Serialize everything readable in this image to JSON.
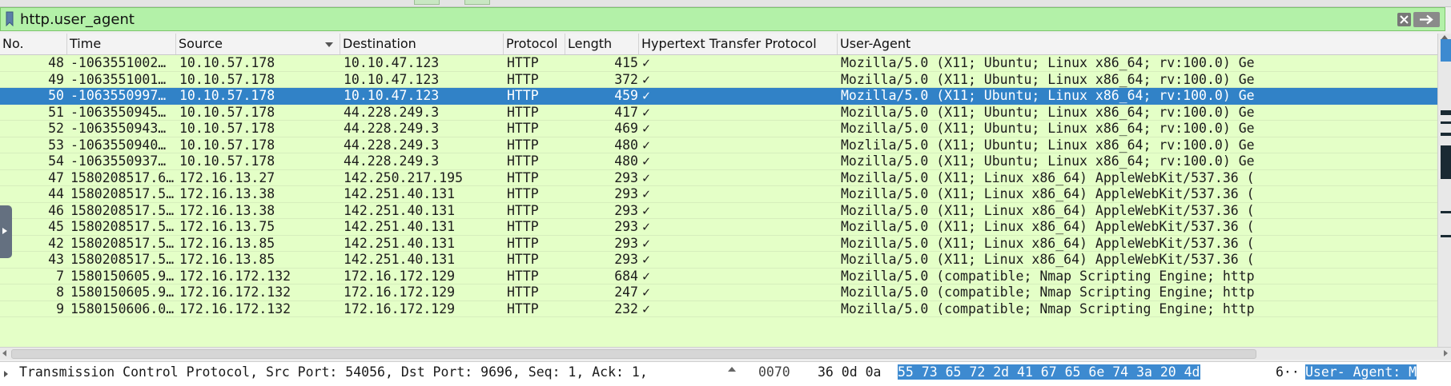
{
  "filter": {
    "value": "http.user_agent"
  },
  "columns": [
    {
      "label": "No."
    },
    {
      "label": "Time"
    },
    {
      "label": "Source"
    },
    {
      "label": "Destination"
    },
    {
      "label": "Protocol"
    },
    {
      "label": "Length"
    },
    {
      "label": "Hypertext Transfer Protocol"
    },
    {
      "label": "User-Agent"
    }
  ],
  "packets": [
    {
      "no": "48",
      "time": "-1063551002…",
      "src": "10.10.57.178",
      "dst": "10.10.47.123",
      "proto": "HTTP",
      "len": "415",
      "http": "✓",
      "ua": "Mozilla/5.0 (X11; Ubuntu; Linux x86_64; rv:100.0) Ge",
      "selected": false
    },
    {
      "no": "49",
      "time": "-1063551001…",
      "src": "10.10.57.178",
      "dst": "10.10.47.123",
      "proto": "HTTP",
      "len": "372",
      "http": "✓",
      "ua": "Mozilla/5.0 (X11; Ubuntu; Linux x86_64; rv:100.0) Ge",
      "selected": false
    },
    {
      "no": "50",
      "time": "-1063550997…",
      "src": "10.10.57.178",
      "dst": "10.10.47.123",
      "proto": "HTTP",
      "len": "459",
      "http": "✓",
      "ua": "Mozilla/5.0 (X11; Ubuntu; Linux x86_64; rv:100.0) Ge",
      "selected": true
    },
    {
      "no": "51",
      "time": "-1063550945…",
      "src": "10.10.57.178",
      "dst": "44.228.249.3",
      "proto": "HTTP",
      "len": "417",
      "http": "✓",
      "ua": "Mozilla/5.0 (X11; Ubuntu; Linux x86_64; rv:100.0) Ge",
      "selected": false
    },
    {
      "no": "52",
      "time": "-1063550943…",
      "src": "10.10.57.178",
      "dst": "44.228.249.3",
      "proto": "HTTP",
      "len": "469",
      "http": "✓",
      "ua": "Mozilla/5.0 (X11; Ubuntu; Linux x86_64; rv:100.0) Ge",
      "selected": false
    },
    {
      "no": "53",
      "time": "-1063550940…",
      "src": "10.10.57.178",
      "dst": "44.228.249.3",
      "proto": "HTTP",
      "len": "480",
      "http": "✓",
      "ua": "Mozlila/5.0 (X11; Ubuntu; Linux x86_64; rv:100.0) Ge",
      "selected": false
    },
    {
      "no": "54",
      "time": "-1063550937…",
      "src": "10.10.57.178",
      "dst": "44.228.249.3",
      "proto": "HTTP",
      "len": "480",
      "http": "✓",
      "ua": "Mozilla/5.0 (X11; Ubuntu; Linux x86_64; rv:100.0) Ge",
      "selected": false
    },
    {
      "no": "47",
      "time": "1580208517.6…",
      "src": "172.16.13.27",
      "dst": "142.250.217.195",
      "proto": "HTTP",
      "len": "293",
      "http": "✓",
      "ua": "Mozilla/5.0 (X11; Linux x86_64) AppleWebKit/537.36 (",
      "selected": false
    },
    {
      "no": "44",
      "time": "1580208517.5…",
      "src": "172.16.13.38",
      "dst": "142.251.40.131",
      "proto": "HTTP",
      "len": "293",
      "http": "✓",
      "ua": "Mozilla/5.0 (X11; Linux x86_64) AppleWebKit/537.36 (",
      "selected": false
    },
    {
      "no": "46",
      "time": "1580208517.5…",
      "src": "172.16.13.38",
      "dst": "142.251.40.131",
      "proto": "HTTP",
      "len": "293",
      "http": "✓",
      "ua": "Mozilla/5.0 (X11; Linux x86_64) AppleWebKit/537.36 (",
      "selected": false
    },
    {
      "no": "45",
      "time": "1580208517.5…",
      "src": "172.16.13.75",
      "dst": "142.251.40.131",
      "proto": "HTTP",
      "len": "293",
      "http": "✓",
      "ua": "Mozilla/5.0 (X11; Linux x86_64) AppleWebKit/537.36 (",
      "selected": false
    },
    {
      "no": "42",
      "time": "1580208517.5…",
      "src": "172.16.13.85",
      "dst": "142.251.40.131",
      "proto": "HTTP",
      "len": "293",
      "http": "✓",
      "ua": "Mozilla/5.0 (X11; Linux x86_64) AppleWebKit/537.36 (",
      "selected": false
    },
    {
      "no": "43",
      "time": "1580208517.5…",
      "src": "172.16.13.85",
      "dst": "142.251.40.131",
      "proto": "HTTP",
      "len": "293",
      "http": "✓",
      "ua": "Mozilla/5.0 (X11; Linux x86_64) AppleWebKit/537.36 (",
      "selected": false
    },
    {
      "no": "7",
      "time": "1580150605.9…",
      "src": "172.16.172.132",
      "dst": "172.16.172.129",
      "proto": "HTTP",
      "len": "684",
      "http": "✓",
      "ua": "Mozilla/5.0 (compatible; Nmap Scripting Engine; http",
      "selected": false
    },
    {
      "no": "8",
      "time": "1580150605.9…",
      "src": "172.16.172.132",
      "dst": "172.16.172.129",
      "proto": "HTTP",
      "len": "247",
      "http": "✓",
      "ua": "Mozilla/5.0 (compatible; Nmap Scripting Engine; http",
      "selected": false
    },
    {
      "no": "9",
      "time": "1580150606.0…",
      "src": "172.16.172.132",
      "dst": "172.16.172.129",
      "proto": "HTTP",
      "len": "232",
      "http": "✓",
      "ua": "Mozilla/5.0 (compatible; Nmap Scripting Engine; http",
      "selected": false
    }
  ],
  "detail": {
    "text": "Transmission Control Protocol, Src Port: 54056, Dst Port: 9696, Seq: 1, Ack: 1,"
  },
  "hex": {
    "offset": "0070",
    "bytes_plain": "36 0d 0a",
    "bytes_hl": "55 73 65 72 2d  41 67 65 6e 74 3a 20 4d",
    "ascii_plain": "6··",
    "ascii_hl": "User- Agent: M"
  },
  "colors": {
    "row_bg": "#e4ffc7",
    "selected_bg": "#3182c7",
    "filter_bg": "#b3f1a8"
  }
}
